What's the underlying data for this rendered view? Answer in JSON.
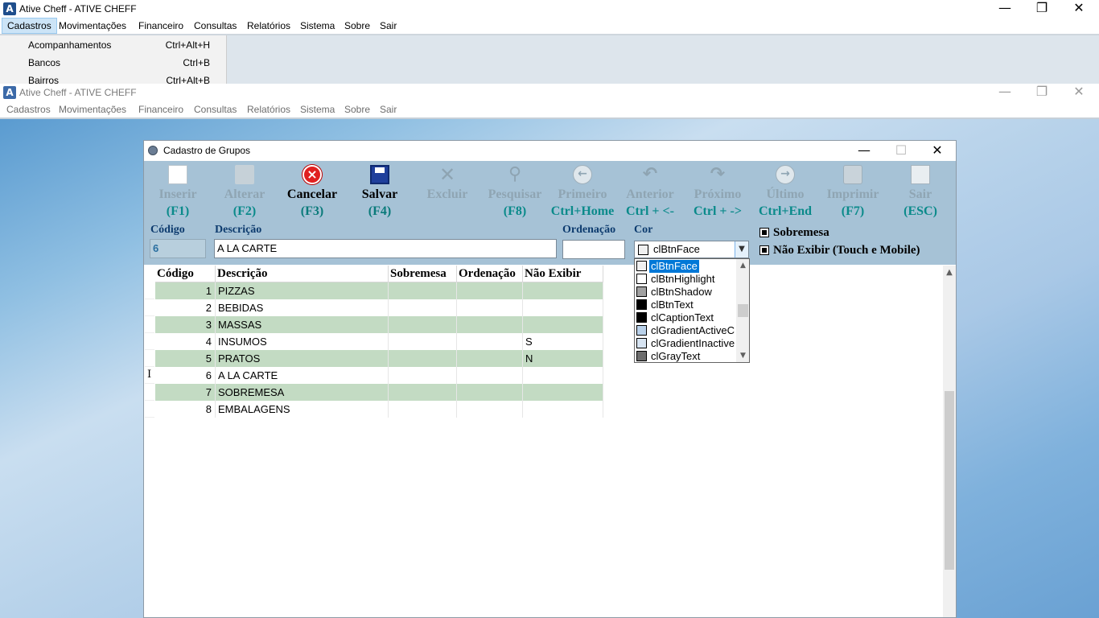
{
  "outer_window": {
    "logo": "A",
    "title": "Ative Cheff - ATIVE CHEFF",
    "menu": [
      "Cadastros",
      "Movimentações",
      "Financeiro",
      "Consultas",
      "Relatórios",
      "Sistema",
      "Sobre",
      "Sair"
    ],
    "menu_open": {
      "items": [
        {
          "label": "Acompanhamentos",
          "shortcut": "Ctrl+Alt+H"
        },
        {
          "label": "Bancos",
          "shortcut": "Ctrl+B"
        },
        {
          "label": "Bairros",
          "shortcut": "Ctrl+Alt+B"
        }
      ]
    },
    "controls": {
      "minimize": "—",
      "restore": "❐",
      "close": "✕"
    }
  },
  "inner_window": {
    "logo": "A",
    "title": "Ative Cheff - ATIVE CHEFF",
    "menu": [
      "Cadastros",
      "Movimentações",
      "Financeiro",
      "Consultas",
      "Relatórios",
      "Sistema",
      "Sobre",
      "Sair"
    ],
    "controls": {
      "minimize": "—",
      "restore": "❐",
      "close": "✕"
    }
  },
  "dialog": {
    "title": "Cadastro de Grupos",
    "controls": {
      "minimize": "—",
      "maximize": "☐",
      "close": "✕"
    },
    "toolbar": [
      {
        "label": "Inserir",
        "key": "(F1)",
        "icon": "document-icon",
        "enabled": false
      },
      {
        "label": "Alterar",
        "key": "(F2)",
        "icon": "edit-folder-icon",
        "enabled": false
      },
      {
        "label": "Cancelar",
        "key": "(F3)",
        "icon": "cancel-icon",
        "enabled": true
      },
      {
        "label": "Salvar",
        "key": "(F4)",
        "icon": "save-icon",
        "enabled": true
      },
      {
        "label": "Excluir",
        "key": "",
        "icon": "delete-x-icon",
        "enabled": false
      },
      {
        "label": "Pesquisar",
        "key": "(F8)",
        "icon": "search-icon",
        "enabled": false
      },
      {
        "label": "Primeiro",
        "key": "Ctrl+Home",
        "icon": "arrow-left-circle-icon",
        "enabled": false
      },
      {
        "label": "Anterior",
        "key": "Ctrl + <-",
        "icon": "undo-arrow-icon",
        "enabled": false
      },
      {
        "label": "Próximo",
        "key": "Ctrl + ->",
        "icon": "redo-arrow-icon",
        "enabled": false
      },
      {
        "label": "Último",
        "key": "Ctrl+End",
        "icon": "arrow-right-circle-icon",
        "enabled": false
      },
      {
        "label": "Imprimir",
        "key": "(F7)",
        "icon": "printer-icon",
        "enabled": false
      },
      {
        "label": "Sair",
        "key": "(ESC)",
        "icon": "exit-icon",
        "enabled": false
      }
    ],
    "form": {
      "codigo_label": "Código",
      "codigo_value": "6",
      "descricao_label": "Descrição",
      "descricao_value": "A LA CARTE",
      "ordenacao_label": "Ordenação",
      "ordenacao_value": "",
      "cor_label": "Cor",
      "cor_value": "clBtnFace",
      "sobremesa_label": "Sobremesa",
      "nao_exibir_label": "Não Exibir (Touch e Mobile)"
    },
    "grid": {
      "columns": [
        "Código",
        "Descrição",
        "Sobremesa",
        "Ordenação",
        "Não Exibir"
      ],
      "rows": [
        {
          "codigo": "1",
          "descricao": "PIZZAS",
          "sobremesa": "",
          "ordenacao": "",
          "nao_exibir": ""
        },
        {
          "codigo": "2",
          "descricao": "BEBIDAS",
          "sobremesa": "",
          "ordenacao": "",
          "nao_exibir": ""
        },
        {
          "codigo": "3",
          "descricao": "MASSAS",
          "sobremesa": "",
          "ordenacao": "",
          "nao_exibir": ""
        },
        {
          "codigo": "4",
          "descricao": "INSUMOS",
          "sobremesa": "",
          "ordenacao": "",
          "nao_exibir": "S"
        },
        {
          "codigo": "5",
          "descricao": "PRATOS",
          "sobremesa": "",
          "ordenacao": "",
          "nao_exibir": "N"
        },
        {
          "codigo": "6",
          "descricao": "A LA CARTE",
          "sobremesa": "",
          "ordenacao": "",
          "nao_exibir": ""
        },
        {
          "codigo": "7",
          "descricao": "SOBREMESA",
          "sobremesa": "",
          "ordenacao": "",
          "nao_exibir": ""
        },
        {
          "codigo": "8",
          "descricao": "EMBALAGENS",
          "sobremesa": "",
          "ordenacao": "",
          "nao_exibir": ""
        }
      ]
    },
    "color_list": [
      {
        "name": "clBtnFace",
        "swatch": "#f0f0f0",
        "selected": true
      },
      {
        "name": "clBtnHighlight",
        "swatch": "#ffffff",
        "selected": false
      },
      {
        "name": "clBtnShadow",
        "swatch": "#a0a0a0",
        "selected": false
      },
      {
        "name": "clBtnText",
        "swatch": "#000000",
        "selected": false
      },
      {
        "name": "clCaptionText",
        "swatch": "#000000",
        "selected": false
      },
      {
        "name": "clGradientActiveC",
        "swatch": "#b9d1ea",
        "selected": false
      },
      {
        "name": "clGradientInactive",
        "swatch": "#d7e4f2",
        "selected": false
      },
      {
        "name": "clGrayText",
        "swatch": "#6d6d6d",
        "selected": false
      }
    ]
  }
}
